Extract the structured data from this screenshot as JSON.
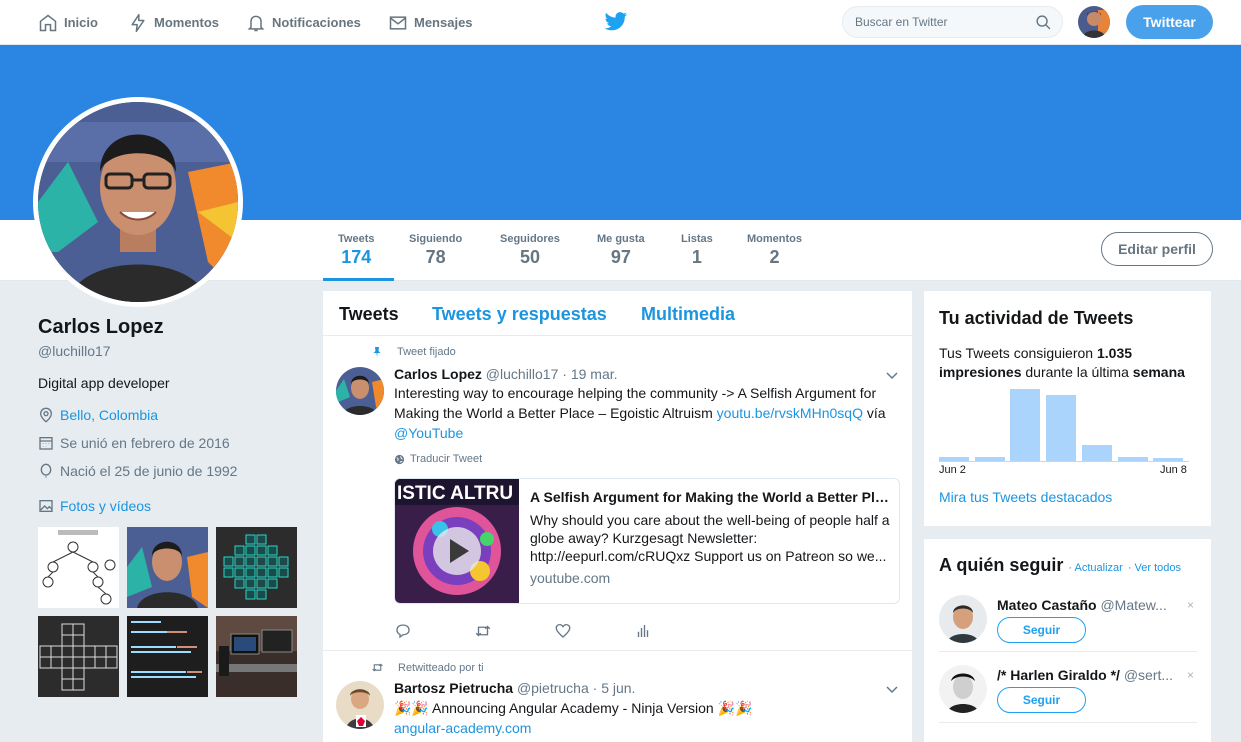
{
  "nav": {
    "home": "Inicio",
    "moments": "Momentos",
    "notifications": "Notificaciones",
    "messages": "Mensajes",
    "search_placeholder": "Buscar en Twitter",
    "tweet_button": "Twittear"
  },
  "profile": {
    "name": "Carlos Lopez",
    "handle": "@luchillo17",
    "bio": "Digital app developer",
    "location": "Bello, Colombia",
    "joined": "Se unió en febrero de 2016",
    "born": "Nació el 25 de junio de 1992",
    "photos_label": "Fotos y vídeos",
    "edit_button": "Editar perfil"
  },
  "stats": [
    {
      "label": "Tweets",
      "value": "174"
    },
    {
      "label": "Siguiendo",
      "value": "78"
    },
    {
      "label": "Seguidores",
      "value": "50"
    },
    {
      "label": "Me gusta",
      "value": "97"
    },
    {
      "label": "Listas",
      "value": "1"
    },
    {
      "label": "Momentos",
      "value": "2"
    }
  ],
  "tabs": [
    "Tweets",
    "Tweets y respuestas",
    "Multimedia"
  ],
  "tweets": [
    {
      "context": "Tweet fijado",
      "name": "Carlos Lopez",
      "handle": "@luchillo17",
      "date": "· 19 mar.",
      "text": "Interesting way to encourage helping the community -> A Selfish Argument for Making the World a Better Place – Egoistic Altruism",
      "link": "youtu.be/rvskMHn0sqQ",
      "via": "vía",
      "mention": "@YouTube",
      "translate": "Traducir Tweet",
      "card": {
        "image_text": "ISTIC ALTRU",
        "title": "A Selfish Argument for Making the World a Better Place – Egoistic Altruism",
        "description": "Why should you care about the well-being of people half a globe away? Kurzgesagt Newsletter: http://eepurl.com/cRUQxz Support us on Patreon so we...",
        "domain": "youtube.com"
      }
    },
    {
      "context": "Retwitteado por ti",
      "name": "Bartosz Pietrucha",
      "handle": "@pietrucha",
      "date": "· 5 jun.",
      "text": "🎉🎉 Announcing Angular Academy - Ninja Version 🎉🎉",
      "link": "angular-academy.com"
    }
  ],
  "activity": {
    "title": "Tu actividad de Tweets",
    "text_prefix": "Tus Tweets consiguieron",
    "impressions": "1.035",
    "impressions_word": "impresiones",
    "text_middle": "durante la última",
    "period": "semana",
    "x_start": "Jun 2",
    "x_end": "Jun 8",
    "link": "Mira tus Tweets destacados",
    "bar_color": "#aad4fb"
  },
  "chart_data": {
    "type": "bar",
    "categories": [
      "Jun 2",
      "Jun 3",
      "Jun 4",
      "Jun 5",
      "Jun 6",
      "Jun 7",
      "Jun 8"
    ],
    "values": [
      4,
      4,
      72,
      66,
      16,
      4,
      3
    ],
    "xlabel": "",
    "ylabel": ""
  },
  "who_to_follow": {
    "title": "A quién seguir",
    "refresh": "Actualizar",
    "view_all": "Ver todos",
    "follow_label": "Seguir",
    "close": "×",
    "items": [
      {
        "name": "Mateo Castaño",
        "handle": "@Matew..."
      },
      {
        "name": "/* Harlen Giraldo */",
        "handle": "@sert..."
      }
    ]
  },
  "colors": {
    "banner": "#2b86e3",
    "accent": "#1b95e0",
    "tweet_button": "#4aa1eb"
  }
}
